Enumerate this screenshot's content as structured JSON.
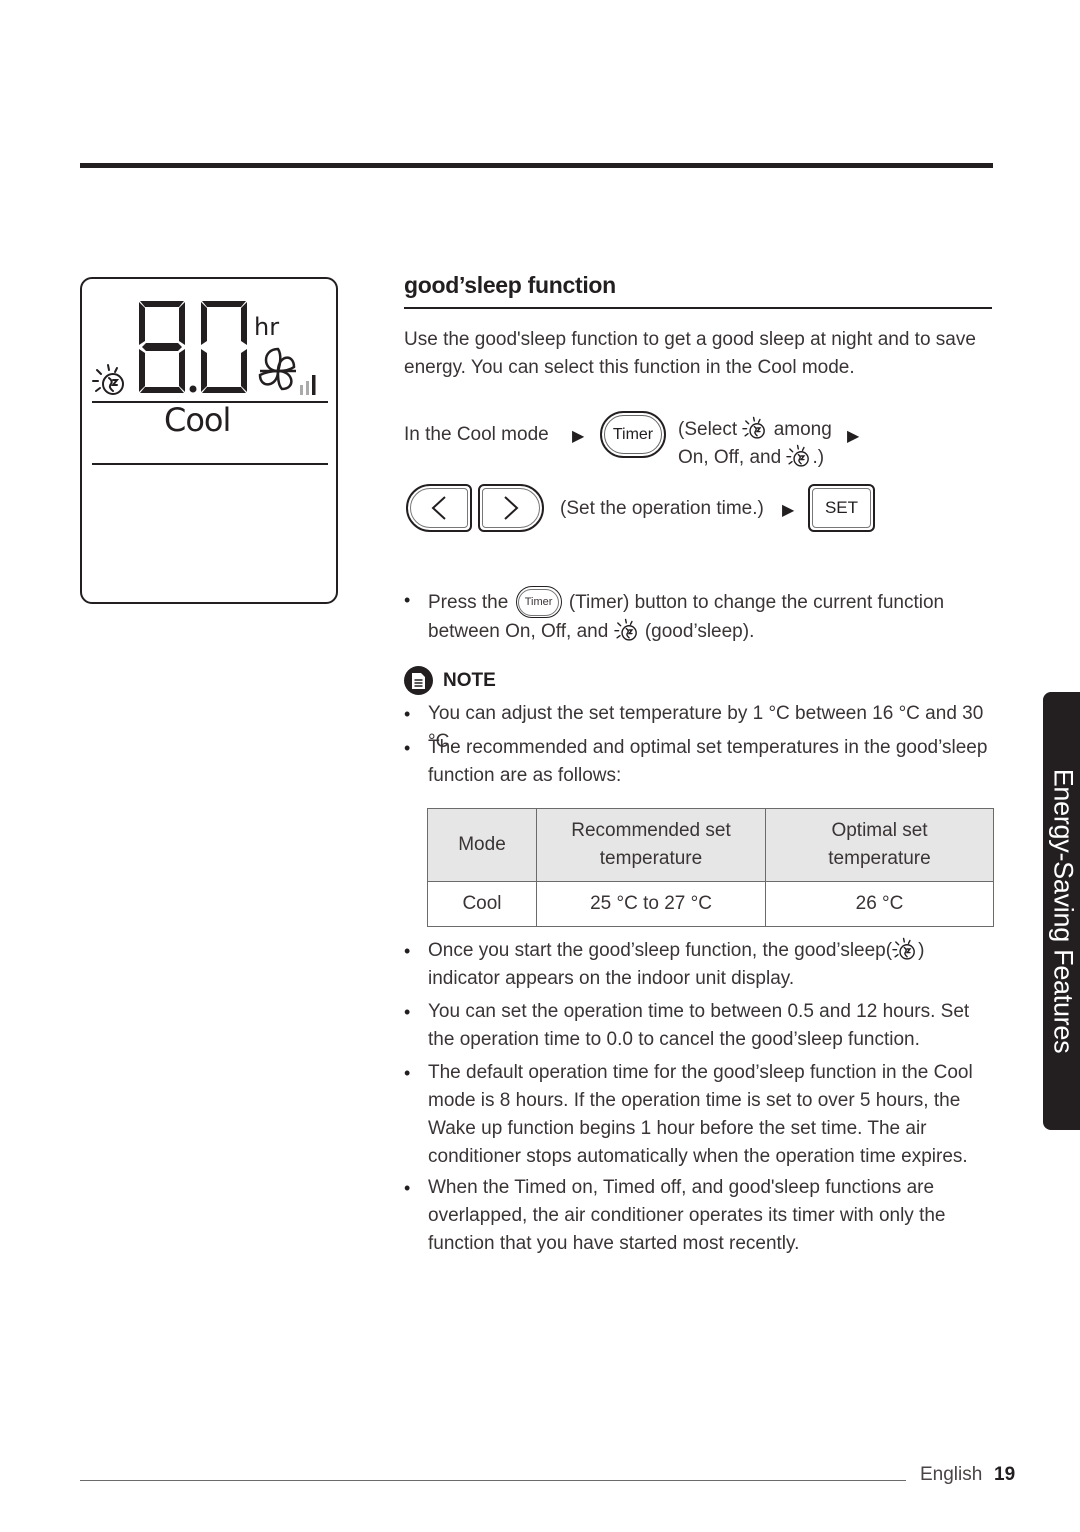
{
  "lcd": {
    "time_value": "8.0",
    "time_unit": "hr",
    "mode": "Cool",
    "fan_speed_bars": 3,
    "fan_speed_level_active": 1,
    "icons": [
      "goodsleep-icon",
      "fan-icon",
      "fan-speed-icon"
    ]
  },
  "section": {
    "title": "good’sleep function",
    "intro": "Use the good'sleep function to get a good sleep at night and to save energy. You can select this function in the Cool mode."
  },
  "steps": {
    "in_cool_mode": "In the Cool mode",
    "timer_button": "Timer",
    "select_prefix": "(Select",
    "select_suffix": "among",
    "select_line2_prefix": "On, Off, and",
    "select_line2_suffix": ".)",
    "set_time": "(Set the operation time.)",
    "set_button": "SET",
    "arrow_glyph": "▶",
    "left_glyph": "<",
    "right_glyph": ">"
  },
  "press_bullet": {
    "prefix": "Press the",
    "timer_label": "Timer",
    "middle": "(Timer) button to change the current function between On, Off, and",
    "suffix": "(good’sleep)."
  },
  "note": {
    "label": "NOTE",
    "bullets": [
      "You can adjust the set temperature by 1 °C between 16 °C and 30 °C.",
      "The recommended and optimal set temperatures in the good’sleep function are as follows:"
    ]
  },
  "table": {
    "headers": [
      "Mode",
      "Recommended set temperature",
      "Optimal set temperature"
    ],
    "rows": [
      [
        "Cool",
        "25 °C to 27 °C",
        "26 °C"
      ]
    ]
  },
  "after_bullets": {
    "indicator_prefix": "Once you start the good’sleep function, the good’sleep(",
    "indicator_suffix": ") indicator appears on the indoor unit display.",
    "items": [
      "You can set the operation time to between 0.5 and 12 hours. Set the operation time to 0.0 to cancel the good’sleep function.",
      "The default operation time for the good’sleep function in the Cool mode is 8 hours. If the operation time is set to over 5 hours, the Wake up function begins 1 hour before the set time. The air conditioner stops automatically when the operation time expires.",
      "When the Timed on, Timed off, and good'sleep functions are overlapped, the air conditioner operates its timer with only the function that you have started most recently."
    ]
  },
  "side_tab": {
    "label": "Energy-Saving Features"
  },
  "footer": {
    "language": "English",
    "page_number": "19"
  },
  "colors": {
    "ink": "#231f20",
    "table_header_bg": "#e6e6e6",
    "fan_bar_inactive": "#aaaaaa"
  }
}
